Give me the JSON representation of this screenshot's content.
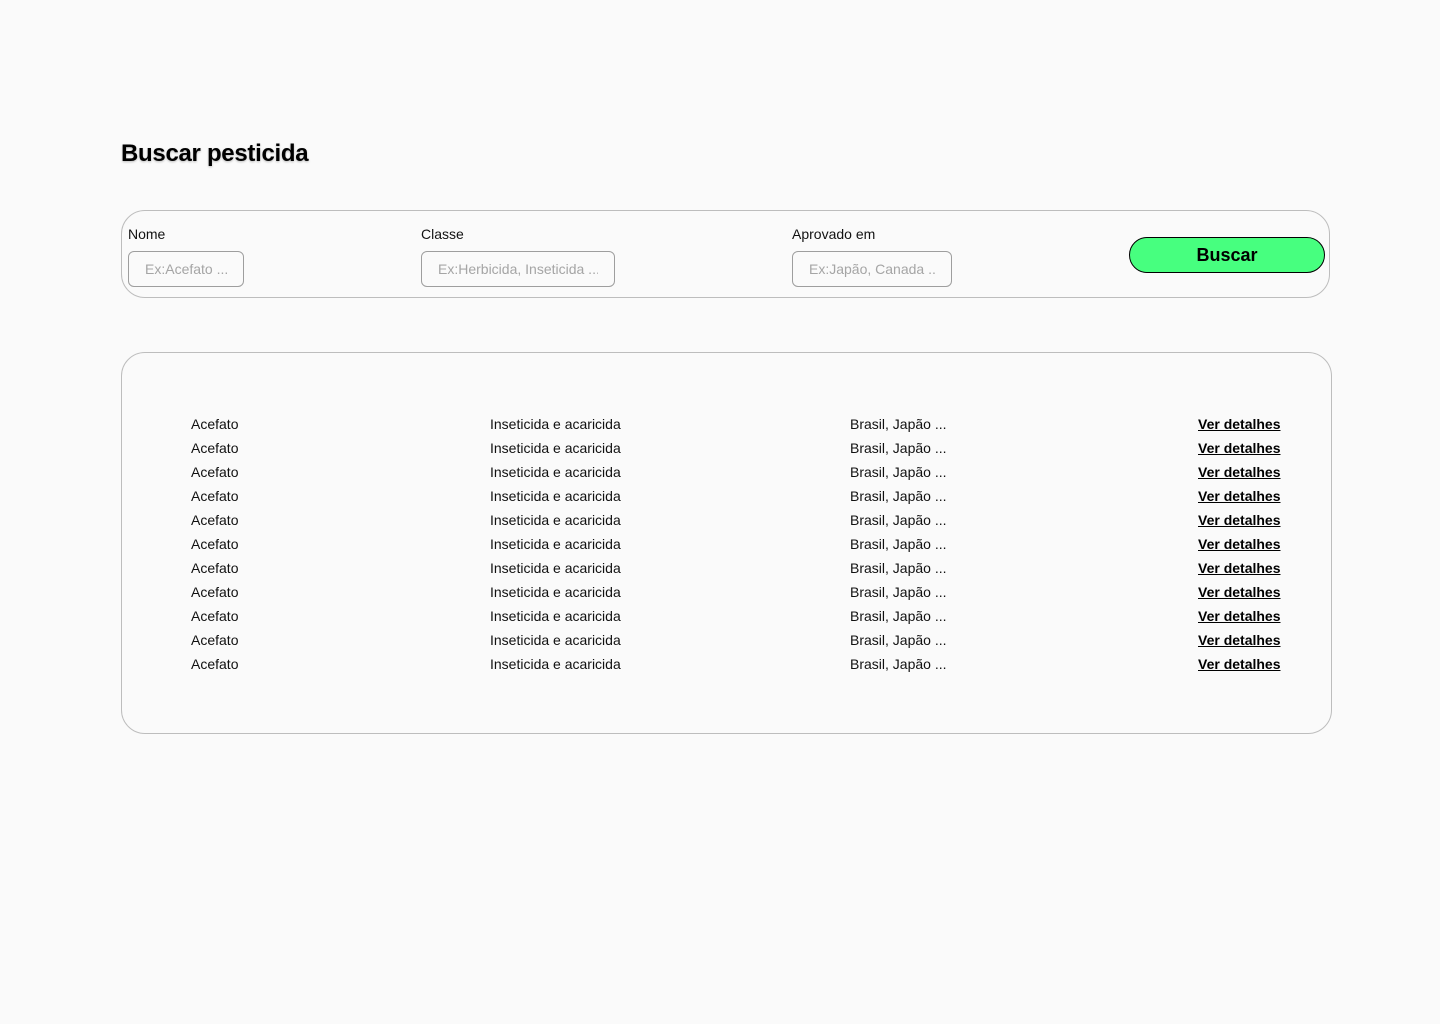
{
  "page": {
    "title": "Buscar pesticida"
  },
  "search": {
    "fields": [
      {
        "label": "Nome",
        "placeholder": "Ex:Acefato ...",
        "value": ""
      },
      {
        "label": "Classe",
        "placeholder": "Ex:Herbicida, Inseticida ...",
        "value": ""
      },
      {
        "label": "Aprovado em",
        "placeholder": "Ex:Japão, Canada ...",
        "value": ""
      }
    ],
    "button_label": "Buscar",
    "button_color": "#47ff7f"
  },
  "results": {
    "link_label": "Ver detalhes",
    "rows": [
      {
        "name": "Acefato",
        "class": "Inseticida e acaricida",
        "approved": "Brasil, Japão ..."
      },
      {
        "name": "Acefato",
        "class": "Inseticida e acaricida",
        "approved": "Brasil, Japão ..."
      },
      {
        "name": "Acefato",
        "class": "Inseticida e acaricida",
        "approved": "Brasil, Japão ..."
      },
      {
        "name": "Acefato",
        "class": "Inseticida e acaricida",
        "approved": "Brasil, Japão ..."
      },
      {
        "name": "Acefato",
        "class": "Inseticida e acaricida",
        "approved": "Brasil, Japão ..."
      },
      {
        "name": "Acefato",
        "class": "Inseticida e acaricida",
        "approved": "Brasil, Japão ..."
      },
      {
        "name": "Acefato",
        "class": "Inseticida e acaricida",
        "approved": "Brasil, Japão ..."
      },
      {
        "name": "Acefato",
        "class": "Inseticida e acaricida",
        "approved": "Brasil, Japão ..."
      },
      {
        "name": "Acefato",
        "class": "Inseticida e acaricida",
        "approved": "Brasil, Japão ..."
      },
      {
        "name": "Acefato",
        "class": "Inseticida e acaricida",
        "approved": "Brasil, Japão ..."
      },
      {
        "name": "Acefato",
        "class": "Inseticida e acaricida",
        "approved": "Brasil, Japão ..."
      }
    ]
  }
}
